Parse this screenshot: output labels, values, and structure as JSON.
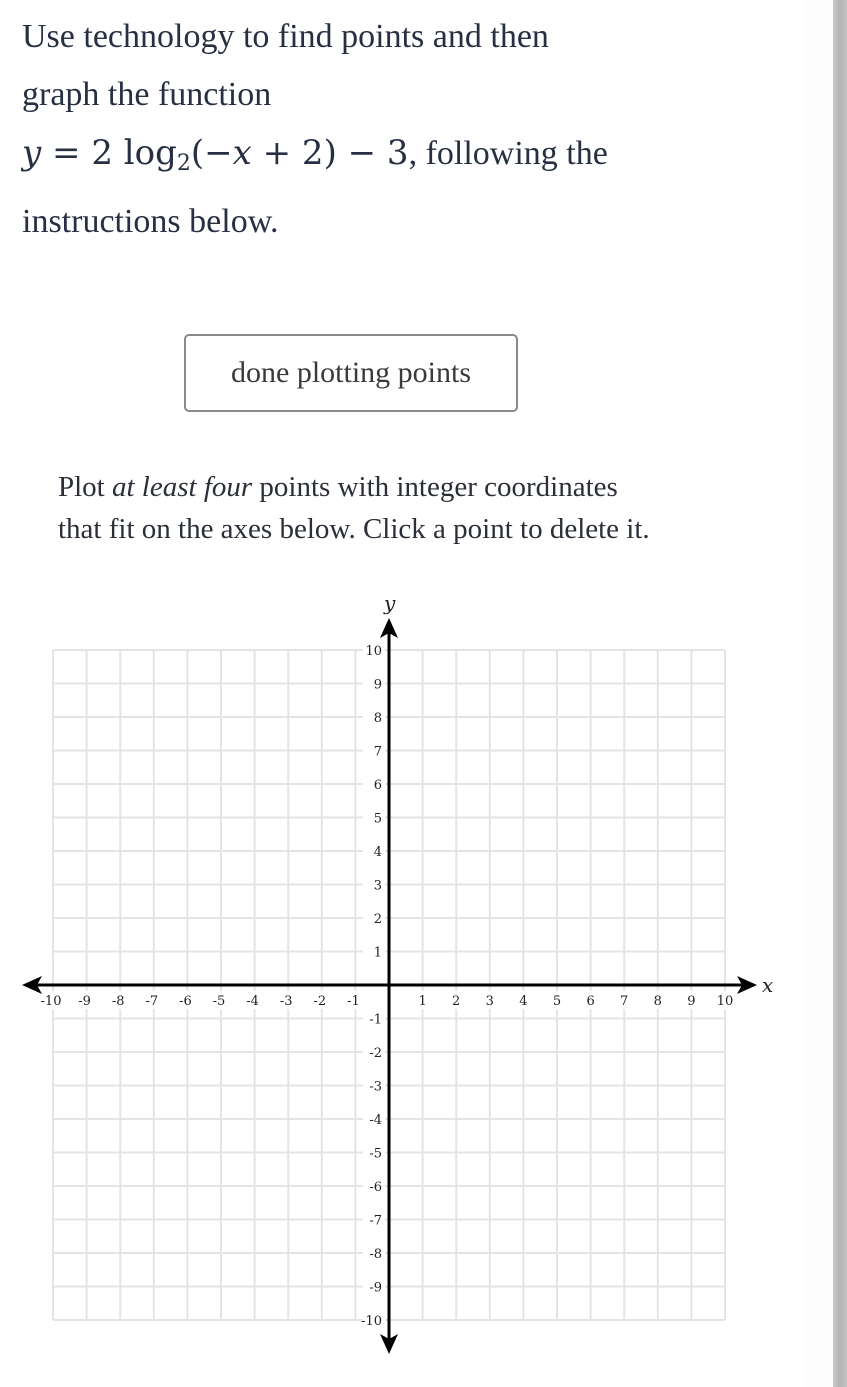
{
  "prompt": {
    "line1": "Use technology to find points and then",
    "line2": "graph the function",
    "equation": {
      "y": "y",
      "equals": " = 2 log",
      "base": "2",
      "arg_open": "(−",
      "x": "x",
      "arg_rest": " + 2) − 3"
    },
    "after_equation": ", following the",
    "line4": "instructions below."
  },
  "done_button": {
    "label": "done plotting points"
  },
  "instructions": {
    "pre": "Plot ",
    "emphasis": "at least four",
    "post_line1": " points with integer coordinates",
    "line2": "that fit on the axes below. Click a point to delete it."
  },
  "graph": {
    "x_label": "x",
    "y_label": "y",
    "x_range": [
      -10,
      10
    ],
    "y_range": [
      -10,
      10
    ],
    "x_ticks": [
      "-10",
      "-9",
      "-8",
      "-7",
      "-6",
      "-5",
      "-4",
      "-3",
      "-2",
      "-1",
      "1",
      "2",
      "3",
      "4",
      "5",
      "6",
      "7",
      "8",
      "9",
      "10"
    ],
    "y_ticks": [
      "10",
      "9",
      "8",
      "7",
      "6",
      "5",
      "4",
      "3",
      "2",
      "1",
      "-1",
      "-2",
      "-3",
      "-4",
      "-5",
      "-6",
      "-7",
      "-8",
      "-9",
      "-10"
    ],
    "plotted_points": [],
    "grid_color": "#e4e4e4",
    "axis_color": "#000000"
  }
}
